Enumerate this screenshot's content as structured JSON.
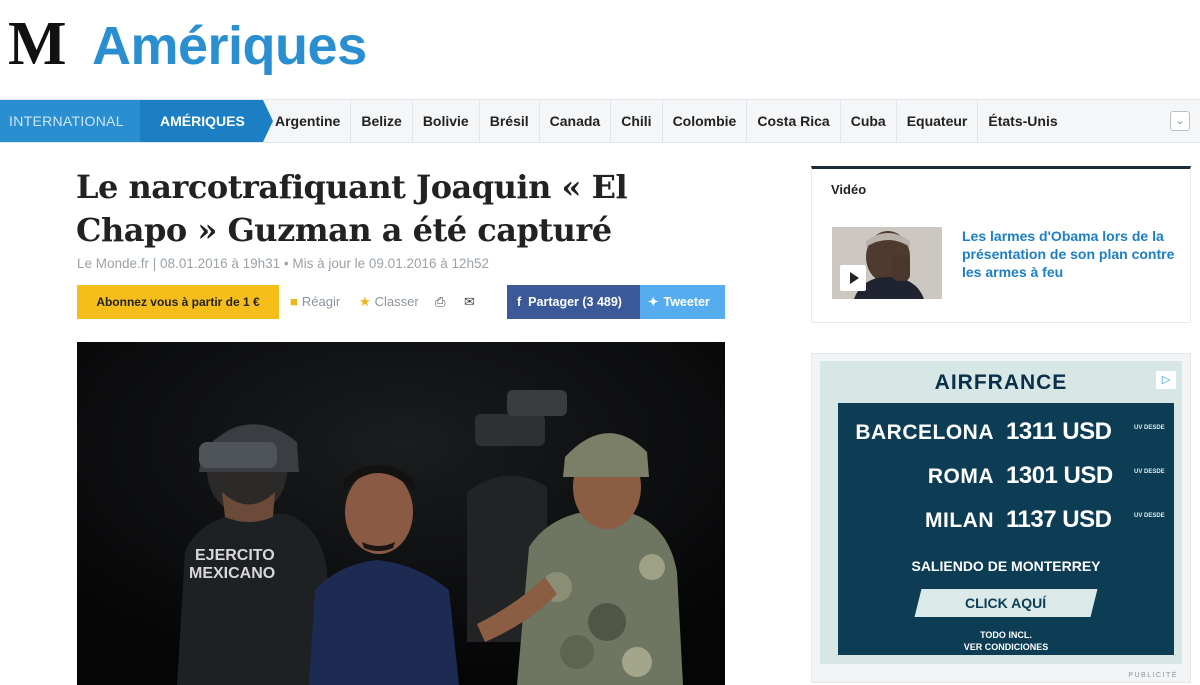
{
  "header": {
    "logo": "M",
    "section_title": "Amériques"
  },
  "nav": {
    "international": "INTERNATIONAL",
    "current": "AMÉRIQUES",
    "countries": [
      "Argentine",
      "Belize",
      "Bolivie",
      "Brésil",
      "Canada",
      "Chili",
      "Colombie",
      "Costa Rica",
      "Cuba",
      "Equateur",
      "États-Unis"
    ],
    "more_icon": "chevron-down-icon"
  },
  "article": {
    "headline": "Le narcotrafiquant Joaquin « El Chapo » Guzman a été capturé",
    "meta": "Le Monde.fr | 08.01.2016 à 19h31 • Mis à jour le 09.01.2016 à 12h52",
    "subscribe": "Abonnez vous à partir de 1 €",
    "react": "Réagir",
    "classer": "Classer",
    "share_facebook": "Partager (3 489)",
    "share_twitter": "Tweeter",
    "photo_vest_text": "EJERCITO MEXICANO"
  },
  "sidebar": {
    "video_label": "Vidéo",
    "video_title": "Les larmes d'Obama lors de la présentation de son plan contre les armes à feu"
  },
  "ad": {
    "brand": "AIRFRANCE",
    "fine": "UV DESDE",
    "offers": [
      {
        "city": "BARCELONA",
        "price": "1311 USD"
      },
      {
        "city": "ROMA",
        "price": "1301 USD"
      },
      {
        "city": "MILAN",
        "price": "1137 USD"
      }
    ],
    "departure": "SALIENDO DE MONTERREY",
    "cta": "CLICK AQUÍ",
    "legal_1": "TODO INCL.",
    "legal_2": "VER CONDICIONES",
    "label": "PUBLICITÉ",
    "colors": {
      "panel": "#0c3d55",
      "background": "#d6e7e5"
    }
  },
  "colors": {
    "brand_blue": "#2a8fd0",
    "subscribe": "#f6be1a",
    "facebook": "#3b5998",
    "twitter": "#55acee"
  }
}
